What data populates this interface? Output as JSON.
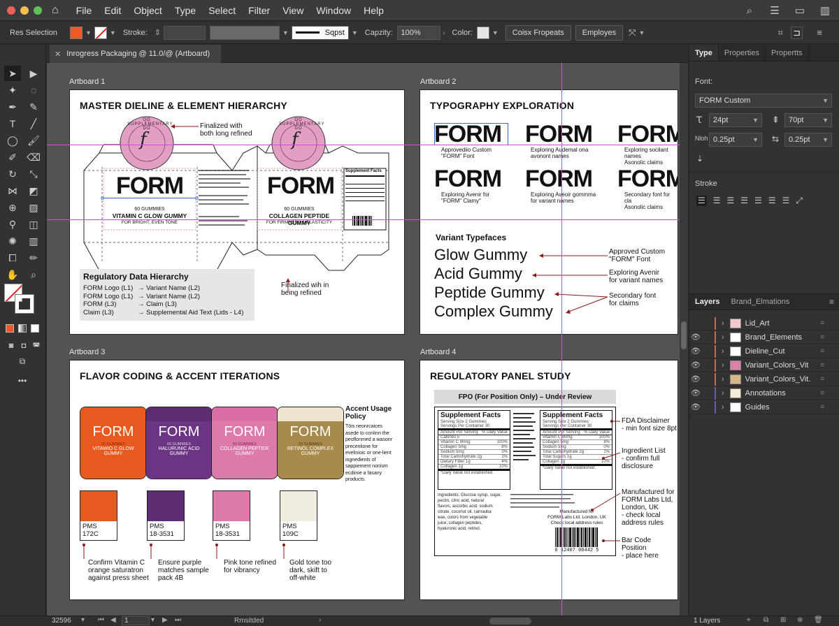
{
  "menubar": {
    "items": [
      "File",
      "Edit",
      "Object",
      "Type",
      "Select",
      "Filter",
      "View",
      "Window",
      "Help"
    ]
  },
  "control": {
    "selection_label": "Res Selection",
    "stroke_label": "Stroke:",
    "stroke_style": "Sqpst",
    "capacity_label": "Capzity:",
    "capacity_value": "100%",
    "color_label": "Color:",
    "btn_color_props": "Coisx Fropeats",
    "btn_employes": "Employes"
  },
  "document": {
    "tab_title": "Inrogress Packaging @ 11.0/@ (Artboard)",
    "close_glyph": "✕"
  },
  "artboard1": {
    "label": "Artboard 1",
    "title": "MASTER DIELINE & ELEMENT HIERARCHY",
    "lid_ring_text": "OO SUPPLEMENTARY DO",
    "lid_letter": "f",
    "brand": "FORM",
    "panel1_line1": "60 GUMMIES",
    "panel1_line2": "VITAMIN C GLOW GUMMY",
    "panel1_line3": "FOR BRIGHT, EVEN TONE",
    "panel2_line1": "60 GUMMIES",
    "panel2_line2": "COLLAGEN PEPTIDE GUMMY",
    "panel2_line3": "FOR FIRMNESS & ELASTICITY",
    "supp_label": "Supplement Facts",
    "note_top_1": "Finalized with",
    "note_top_2": "both long refined",
    "note_bottom_1": "Finalized wih in",
    "note_bottom_2": "being refined",
    "hier_title": "Regulatory Data Hierarchy",
    "hier_rows": [
      {
        "left": "FORM Logo (L1)",
        "right": "Variant Name (L2)"
      },
      {
        "left": "FORM Logo (L1)",
        "right": "Variant Name (L2)"
      },
      {
        "left": "FORM (L3)",
        "right": "Claim (L3)"
      },
      {
        "left": "Claim (L3)",
        "right": "Supplemental Aid Text (Lids - L4)"
      }
    ],
    "arrow_glyph": "→"
  },
  "artboard2": {
    "label": "Artboard 2",
    "title": "TYPOGRAPHY EXPLORATION",
    "form_word": "FORM",
    "captions": [
      [
        "Approvediio Custom",
        "\"FORM\" Font"
      ],
      [
        "Exploring Audemal ona",
        "avonont names"
      ],
      [
        "Exploring socilant names",
        "Asonolic claims"
      ],
      [
        "Exploring Avenir for",
        "\"FORM\" Clamy\""
      ],
      [
        "Exploring Aveoir gommma",
        "for variant names"
      ],
      [
        "Secondary font for cla",
        "Asonolic claims"
      ]
    ],
    "variant_heading": "Variant Typefaces",
    "variants": [
      "Glow Gummy",
      "Acid Gummy",
      "Peptide Gummy",
      "Complex Gummy"
    ],
    "notes": [
      [
        "Approved Custom",
        "\"FORM\" Font"
      ],
      [
        "Exploring Avenir",
        "for variant names"
      ],
      [
        "Secondary font",
        "for claims"
      ]
    ]
  },
  "artboard3": {
    "label": "Artboard 3",
    "title": "FLAVOR CODING & ACCENT ITERATIONS",
    "brand": "FORM",
    "jars": [
      {
        "count": "60 GUMMIES",
        "name1": "VITAWIO C GLOW",
        "name2": "GUMMY",
        "lid": "#e8591f",
        "body": "#e8591f",
        "text": "#fff",
        "sub": "#fbe5d7"
      },
      {
        "count": "60 GUMMIES",
        "name1": "HALURUNIC ACID",
        "name2": "GUMMY",
        "lid": "#5c2d73",
        "body": "#6b3583",
        "text": "#fff",
        "sub": "#eee"
      },
      {
        "count": "60 GUMMIES",
        "name1": "COLLAGEN PEPTIDE",
        "name2": "GUMMY",
        "lid": "#d86ea4",
        "body": "#de79ac",
        "text": "#fff",
        "sub": "#fbe8f1"
      },
      {
        "count": "60 GUMMIES",
        "name1": "RETINOL COMPLEX",
        "name2": "GUMMY",
        "lid": "#efe6d2",
        "body": "#a88a4c",
        "text": "#fff",
        "sub": "#f5ecd6"
      }
    ],
    "policy_title_1": "Accent Usage",
    "policy_title_2": "Policy",
    "policy_lines": [
      "Tōis neonrcaices",
      "asede to conlinn the",
      "peoflonmed a wasonr",
      "precenlione for",
      "evelinioic or one-lient",
      "ingnedients of",
      "sappiement nonism",
      "ecdiinie a fasany",
      "products."
    ],
    "swatches": [
      {
        "pms1": "PMS",
        "pms2": "172C",
        "color": "#e8591f"
      },
      {
        "pms1": "PMS",
        "pms2": "18-3531",
        "color": "#5c2d73"
      },
      {
        "pms1": "PMS",
        "pms2": "18-3531",
        "color": "#de79ac"
      },
      {
        "pms1": "PMS",
        "pms2": "109C",
        "color": "#f1ece0"
      }
    ],
    "notes": [
      [
        "Confirm Vitamin C",
        "orange saturatron",
        "against press sheet"
      ],
      [
        "Ensure purple",
        "matches sample",
        "pack 4B"
      ],
      [
        "Pink tone refined",
        "for vibrancy"
      ],
      [
        "Gold tone too",
        "dark, skift to",
        "off-white"
      ]
    ]
  },
  "artboard4": {
    "label": "Artboard 4",
    "title": "REGULATORY PANEL STUDY",
    "fpo": "FPO (For Position Only) – Under Review",
    "supp_title": "Supplement Facts",
    "supp_sub1": "Serving Size 2 Gummies",
    "supp_sub2": "Servings Per Container 30",
    "supp_rows": [
      [
        "Amount Per Serving",
        "% Daily Value"
      ],
      [
        "Calories 5",
        ""
      ],
      [
        "Vitamin C 90mg",
        "100%"
      ],
      [
        "Collagen 5mg",
        "8%"
      ],
      [
        "Sodium 5mg",
        "0%"
      ],
      [
        "Total Carbohydrate 2g",
        "1%"
      ],
      [
        "Dietary Fiber 1g",
        "4%"
      ],
      [
        "Total Sugars 1g",
        ""
      ],
      [
        "Collagen 1g",
        "10%"
      ]
    ],
    "supp_foot": "*Daily Value not established.",
    "ingredients": [
      "Ingredients: Glucose syrup, sugar,",
      "pectin, citric acid, natural",
      "flavors, ascorbic acid, sodium",
      "citrate, coconut oil, carnauba",
      "wax, colors from vegetable",
      "juice, collagen peptides,",
      "hyaluronic acid, retinol."
    ],
    "mfr_1": "Manufactured for",
    "mfr_2": "FORM Labs Ltd. London, UK",
    "mfr_3": "Check local address rules",
    "barcode_number": "0 12407 00442 5",
    "notes": [
      [
        "FDA Disclaimer",
        "- min font size 8pt"
      ],
      [
        "Ingredient List",
        "- confirm full",
        "disclosure"
      ],
      [
        "Manufactured for",
        "FORM Labs Ltd,",
        "London, UK",
        "- check local",
        "address rules"
      ],
      [
        "Bar Code Position",
        "- place here"
      ]
    ]
  },
  "panel": {
    "tabs": [
      "Type",
      "Properties",
      "Propertts"
    ],
    "font_label": "Font:",
    "font_value": "FORM Custom",
    "size_value": "24pt",
    "leading_value": "70pt",
    "kern_label": "Nloh",
    "kern_value": "0.25pt",
    "track_value": "0.25pt",
    "stroke_label": "Stroke",
    "layers_tabs": [
      "Layers",
      "Brand_Elmations"
    ],
    "layers": [
      {
        "name": "Lid_Art",
        "color": "#e06040",
        "thumb": "#f3c8cc",
        "eye": false
      },
      {
        "name": "Brand_Elements",
        "color": "#e06040",
        "thumb": "#ffffff",
        "eye": true
      },
      {
        "name": "Dieline_Cut",
        "color": "#e06040",
        "thumb": "#ffffff",
        "eye": true
      },
      {
        "name": "Variant_Colors_Vit",
        "color": "#e06040",
        "thumb": "#d983a8",
        "eye": true
      },
      {
        "name": "Variant_Colors_Vit.",
        "color": "#e06040",
        "thumb": "#d7b58c",
        "eye": true
      },
      {
        "name": "Annotations",
        "color": "#6a5ad0",
        "thumb": "#f5ead5",
        "eye": true
      },
      {
        "name": "Guides",
        "color": "#6a5ad0",
        "thumb": "#ffffff",
        "eye": true
      }
    ],
    "layers_count": "1 Layers"
  },
  "status": {
    "zoom": "32596",
    "page": "1",
    "center_text": "Rmsitded"
  },
  "colors": {
    "fill": "#f05a28",
    "guide": "#d050d0",
    "annotation": "#8b1a1a"
  }
}
